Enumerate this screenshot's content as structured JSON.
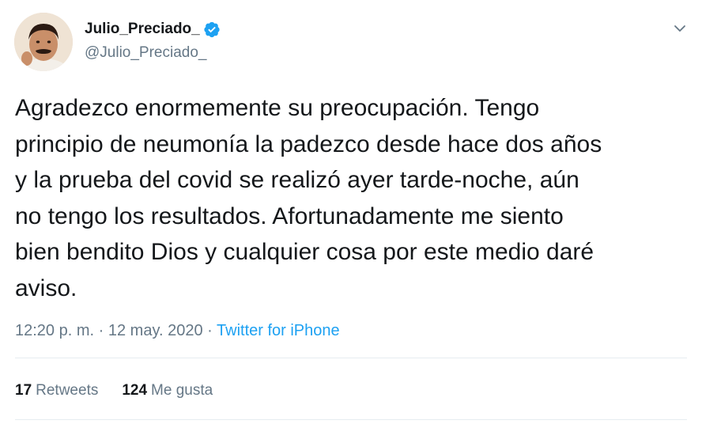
{
  "user": {
    "display_name": "Julio_Preciado_",
    "handle": "@Julio_Preciado_",
    "verified": true,
    "verified_icon": "verified-badge-icon",
    "avatar": "profile-photo"
  },
  "tweet": {
    "text": "Agradezco enormemente su preocupación. Tengo\nprincipio de neumonía la padezco desde hace dos años\ny la prueba del covid se realizó ayer tarde-noche, aún\nno tengo los resultados. Afortunadamente me siento\nbien bendito Dios y cualquier cosa por este medio daré\naviso.",
    "time": "12:20 p. m.",
    "separator": "·",
    "date": "12 may. 2020",
    "source": "Twitter for iPhone"
  },
  "stats": {
    "retweets_count": "17",
    "retweets_label": "Retweets",
    "likes_count": "124",
    "likes_label": "Me gusta"
  },
  "colors": {
    "text": "#14171a",
    "secondary": "#657786",
    "accent": "#1da1f2",
    "divider": "#e6ecf0"
  },
  "icons": {
    "menu": "chevron-down-icon"
  }
}
